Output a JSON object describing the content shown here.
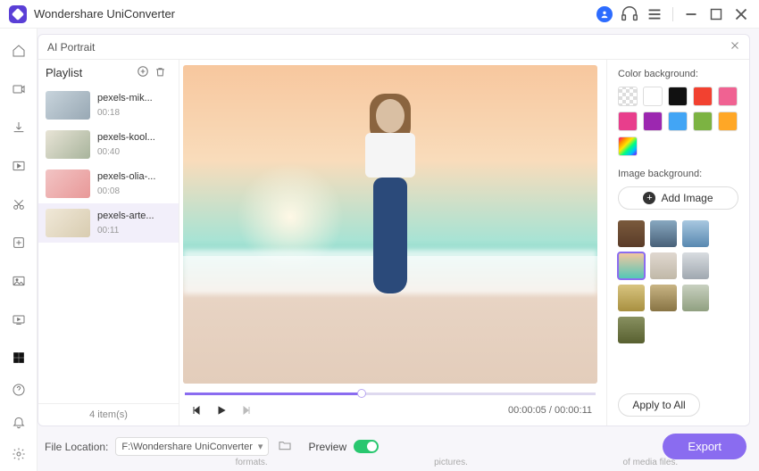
{
  "titlebar": {
    "app_name": "Wondershare UniConverter"
  },
  "panel": {
    "title": "AI Portrait",
    "playlist_label": "Playlist",
    "items": [
      {
        "name": "pexels-mik...",
        "duration": "00:18"
      },
      {
        "name": "pexels-kool...",
        "duration": "00:40"
      },
      {
        "name": "pexels-olia-...",
        "duration": "00:08"
      },
      {
        "name": "pexels-arte...",
        "duration": "00:11"
      }
    ],
    "item_count": "4 item(s)",
    "time_current": "00:00:05",
    "time_total": "00:00:11"
  },
  "right": {
    "color_bg_label": "Color background:",
    "image_bg_label": "Image background:",
    "add_image": "Add Image",
    "apply_all": "Apply to All",
    "colors": [
      {
        "kind": "transparent"
      },
      {
        "hex": "#ffffff"
      },
      {
        "hex": "#111111"
      },
      {
        "hex": "#f24130"
      },
      {
        "hex": "#f06292"
      },
      {
        "hex": "#e83e8c"
      },
      {
        "hex": "#9c27b0"
      },
      {
        "hex": "#42a5f5"
      },
      {
        "hex": "#7cb342"
      },
      {
        "hex": "#ffa726"
      },
      {
        "kind": "rainbow"
      }
    ],
    "image_thumbs": 10,
    "selected_thumb_index": 3
  },
  "bottombar": {
    "file_location_label": "File Location:",
    "path": "F:\\Wondershare UniConverter",
    "preview_label": "Preview",
    "export_label": "Export"
  },
  "bottom_snippets": [
    "formats.",
    "pictures.",
    "of media files."
  ]
}
